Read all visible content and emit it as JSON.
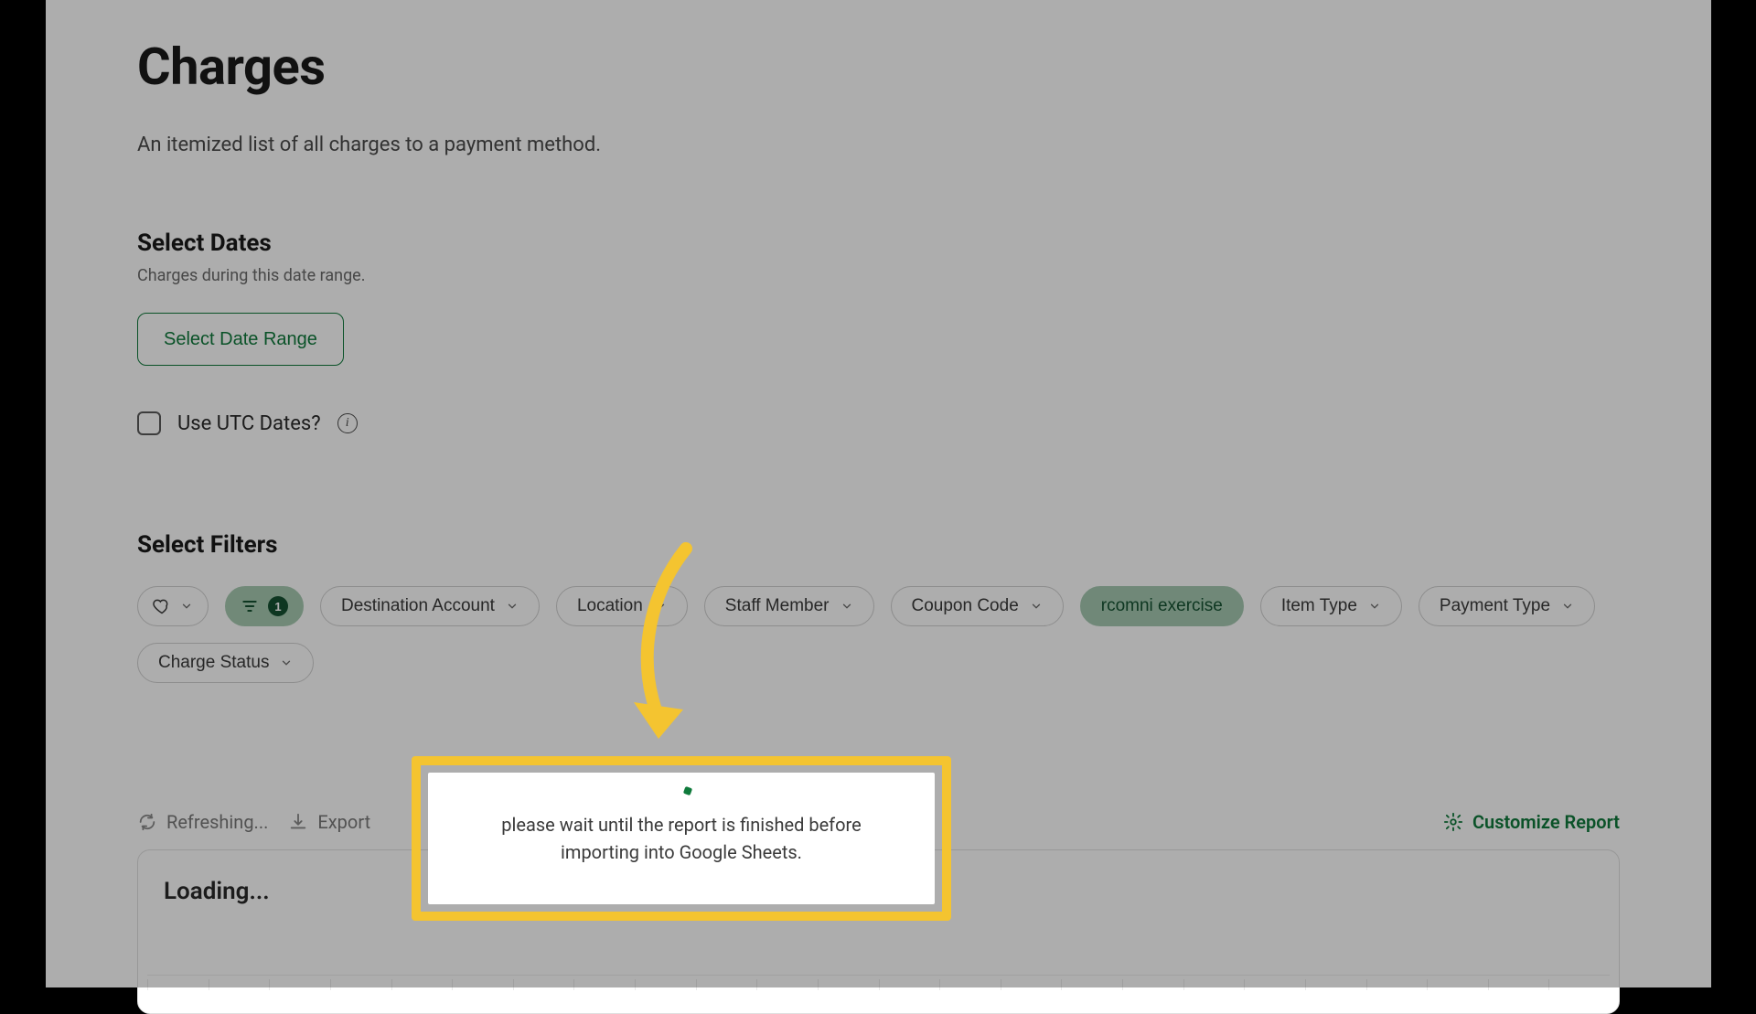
{
  "page": {
    "title": "Charges",
    "subtitle": "An itemized list of all charges to a payment method."
  },
  "dates": {
    "heading": "Select Dates",
    "hint": "Charges during this date range.",
    "button": "Select Date Range",
    "utc_label": "Use UTC Dates?"
  },
  "filters": {
    "heading": "Select Filters",
    "active_count": "1",
    "items": [
      {
        "label": "Destination Account",
        "active": false
      },
      {
        "label": "Location",
        "active": false
      },
      {
        "label": "Staff Member",
        "active": false
      },
      {
        "label": "Coupon Code",
        "active": false
      },
      {
        "label": "rcomni exercise",
        "active": true
      },
      {
        "label": "Item Type",
        "active": false
      },
      {
        "label": "Payment Type",
        "active": false
      },
      {
        "label": "Charge Status",
        "active": false
      }
    ]
  },
  "toolbar": {
    "refreshing": "Refreshing...",
    "export": "Export",
    "customize": "Customize Report"
  },
  "table": {
    "loading": "Loading..."
  },
  "popup": {
    "message": "please wait until the report is finished before importing into Google Sheets."
  }
}
